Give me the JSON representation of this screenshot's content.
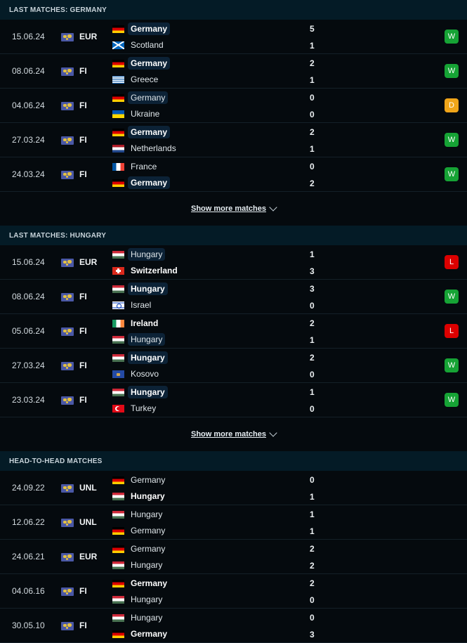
{
  "colors": {
    "win": "#16a335",
    "draw": "#f0a519",
    "loss": "#dc0000"
  },
  "sections": [
    {
      "title": "Last matches: Germany",
      "show_more": "Show more matches",
      "matches": [
        {
          "date": "15.06.24",
          "comp": "EUR",
          "home": {
            "name": "Germany",
            "flag": "de",
            "bold": true,
            "hl": true
          },
          "away": {
            "name": "Scotland",
            "flag": "sct",
            "bold": false,
            "hl": false
          },
          "score_home": "5",
          "score_away": "1",
          "result": "W"
        },
        {
          "date": "08.06.24",
          "comp": "FI",
          "home": {
            "name": "Germany",
            "flag": "de",
            "bold": true,
            "hl": true
          },
          "away": {
            "name": "Greece",
            "flag": "gr",
            "bold": false,
            "hl": false
          },
          "score_home": "2",
          "score_away": "1",
          "result": "W"
        },
        {
          "date": "04.06.24",
          "comp": "FI",
          "home": {
            "name": "Germany",
            "flag": "de",
            "bold": false,
            "hl": true
          },
          "away": {
            "name": "Ukraine",
            "flag": "ua",
            "bold": false,
            "hl": false
          },
          "score_home": "0",
          "score_away": "0",
          "result": "D"
        },
        {
          "date": "27.03.24",
          "comp": "FI",
          "home": {
            "name": "Germany",
            "flag": "de",
            "bold": true,
            "hl": true
          },
          "away": {
            "name": "Netherlands",
            "flag": "nl",
            "bold": false,
            "hl": false
          },
          "score_home": "2",
          "score_away": "1",
          "result": "W"
        },
        {
          "date": "24.03.24",
          "comp": "FI",
          "home": {
            "name": "France",
            "flag": "fr",
            "bold": false,
            "hl": false
          },
          "away": {
            "name": "Germany",
            "flag": "de",
            "bold": true,
            "hl": true
          },
          "score_home": "0",
          "score_away": "2",
          "result": "W"
        }
      ]
    },
    {
      "title": "Last matches: Hungary",
      "show_more": "Show more matches",
      "matches": [
        {
          "date": "15.06.24",
          "comp": "EUR",
          "home": {
            "name": "Hungary",
            "flag": "hu",
            "bold": false,
            "hl": true
          },
          "away": {
            "name": "Switzerland",
            "flag": "ch",
            "bold": true,
            "hl": false
          },
          "score_home": "1",
          "score_away": "3",
          "result": "L"
        },
        {
          "date": "08.06.24",
          "comp": "FI",
          "home": {
            "name": "Hungary",
            "flag": "hu",
            "bold": true,
            "hl": true
          },
          "away": {
            "name": "Israel",
            "flag": "il",
            "bold": false,
            "hl": false
          },
          "score_home": "3",
          "score_away": "0",
          "result": "W"
        },
        {
          "date": "05.06.24",
          "comp": "FI",
          "home": {
            "name": "Ireland",
            "flag": "ie",
            "bold": true,
            "hl": false
          },
          "away": {
            "name": "Hungary",
            "flag": "hu",
            "bold": false,
            "hl": true
          },
          "score_home": "2",
          "score_away": "1",
          "result": "L"
        },
        {
          "date": "27.03.24",
          "comp": "FI",
          "home": {
            "name": "Hungary",
            "flag": "hu",
            "bold": true,
            "hl": true
          },
          "away": {
            "name": "Kosovo",
            "flag": "xk",
            "bold": false,
            "hl": false
          },
          "score_home": "2",
          "score_away": "0",
          "result": "W"
        },
        {
          "date": "23.03.24",
          "comp": "FI",
          "home": {
            "name": "Hungary",
            "flag": "hu",
            "bold": true,
            "hl": true
          },
          "away": {
            "name": "Turkey",
            "flag": "tr",
            "bold": false,
            "hl": false
          },
          "score_home": "1",
          "score_away": "0",
          "result": "W"
        }
      ]
    },
    {
      "title": "Head-to-head matches",
      "show_more": null,
      "matches": [
        {
          "date": "24.09.22",
          "comp": "UNL",
          "home": {
            "name": "Germany",
            "flag": "de",
            "bold": false,
            "hl": false
          },
          "away": {
            "name": "Hungary",
            "flag": "hu",
            "bold": true,
            "hl": false
          },
          "score_home": "0",
          "score_away": "1",
          "result": null
        },
        {
          "date": "12.06.22",
          "comp": "UNL",
          "home": {
            "name": "Hungary",
            "flag": "hu",
            "bold": false,
            "hl": false
          },
          "away": {
            "name": "Germany",
            "flag": "de",
            "bold": false,
            "hl": false
          },
          "score_home": "1",
          "score_away": "1",
          "result": null
        },
        {
          "date": "24.06.21",
          "comp": "EUR",
          "home": {
            "name": "Germany",
            "flag": "de",
            "bold": false,
            "hl": false
          },
          "away": {
            "name": "Hungary",
            "flag": "hu",
            "bold": false,
            "hl": false
          },
          "score_home": "2",
          "score_away": "2",
          "result": null
        },
        {
          "date": "04.06.16",
          "comp": "FI",
          "home": {
            "name": "Germany",
            "flag": "de",
            "bold": true,
            "hl": false
          },
          "away": {
            "name": "Hungary",
            "flag": "hu",
            "bold": false,
            "hl": false
          },
          "score_home": "2",
          "score_away": "0",
          "result": null
        },
        {
          "date": "30.05.10",
          "comp": "FI",
          "home": {
            "name": "Hungary",
            "flag": "hu",
            "bold": false,
            "hl": false
          },
          "away": {
            "name": "Germany",
            "flag": "de",
            "bold": true,
            "hl": false
          },
          "score_home": "0",
          "score_away": "3",
          "result": null
        }
      ]
    }
  ]
}
